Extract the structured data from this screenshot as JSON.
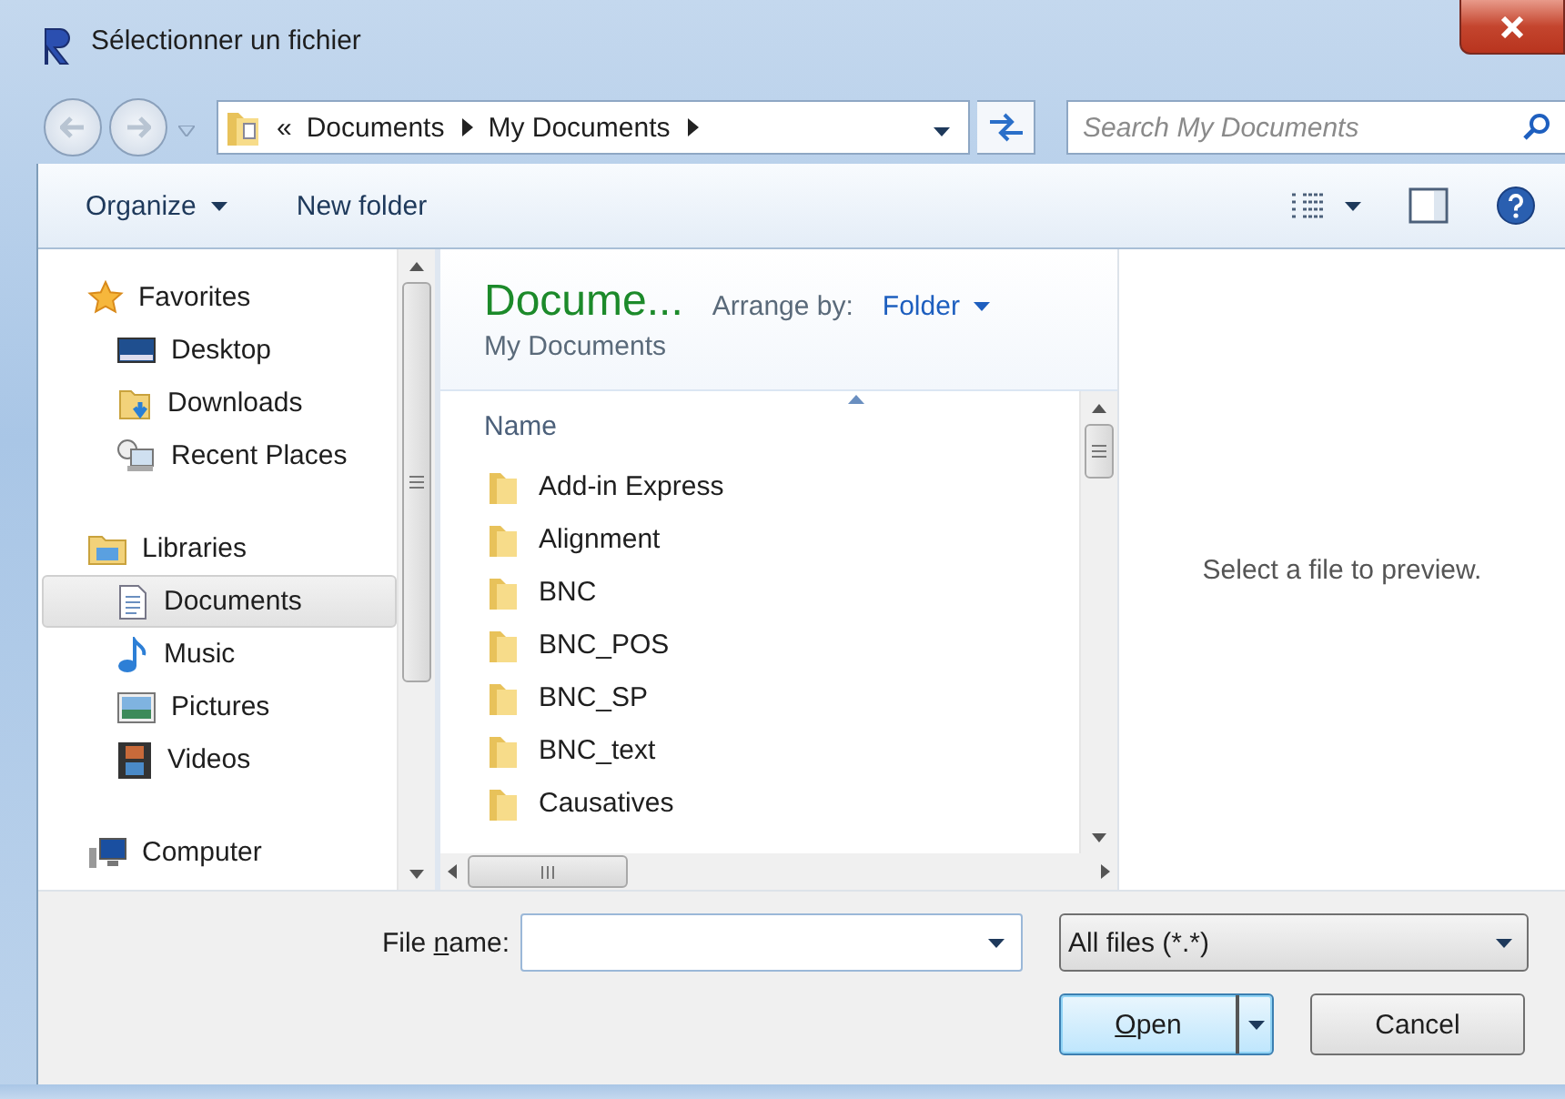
{
  "window": {
    "title": "Sélectionner un fichier"
  },
  "address_bar": {
    "overflow": "«",
    "crumbs": [
      "Documents",
      "My Documents"
    ]
  },
  "search": {
    "placeholder": "Search My Documents"
  },
  "toolbar": {
    "buttons": [
      {
        "label": "Organize",
        "has_menu": true
      },
      {
        "label": "New folder",
        "has_menu": false
      }
    ]
  },
  "navigation": [
    {
      "label": "Favorites",
      "kind": "star",
      "selected": false,
      "children": [
        {
          "label": "Desktop",
          "kind": "desktop",
          "selected": false
        },
        {
          "label": "Downloads",
          "kind": "downloads",
          "selected": false
        },
        {
          "label": "Recent Places",
          "kind": "recent",
          "selected": false
        }
      ]
    },
    {
      "label": "Libraries",
      "kind": "library",
      "selected": false,
      "children": [
        {
          "label": "Documents",
          "kind": "document",
          "selected": true
        },
        {
          "label": "Music",
          "kind": "music",
          "selected": false
        },
        {
          "label": "Pictures",
          "kind": "pictures",
          "selected": false
        },
        {
          "label": "Videos",
          "kind": "videos",
          "selected": false
        }
      ]
    },
    {
      "label": "Computer",
      "kind": "computer",
      "selected": false
    }
  ],
  "library_header": {
    "title": "Docume...",
    "subtitle": "My Documents",
    "arrange_label": "Arrange by:",
    "arrange_value": "Folder"
  },
  "file_list": {
    "column": "Name",
    "items": [
      "Add-in Express",
      "Alignment",
      "BNC",
      "BNC_POS",
      "BNC_SP",
      "BNC_text",
      "Causatives"
    ]
  },
  "preview": {
    "message": "Select a file to preview."
  },
  "file_name": {
    "label_parts": [
      {
        "text": "File ",
        "underline": false
      },
      {
        "text": "n",
        "underline": true
      },
      {
        "text": "ame:",
        "underline": false
      }
    ]
  },
  "file_type": {
    "value": "All files (*.*)"
  },
  "buttons": [
    {
      "kind": "split",
      "default": true,
      "label_parts": [
        {
          "text": "O",
          "underline": true
        },
        {
          "text": "pen",
          "underline": false
        }
      ]
    },
    {
      "kind": "plain",
      "default": false,
      "label_parts": [
        {
          "text": "Cancel",
          "underline": false
        }
      ]
    }
  ]
}
